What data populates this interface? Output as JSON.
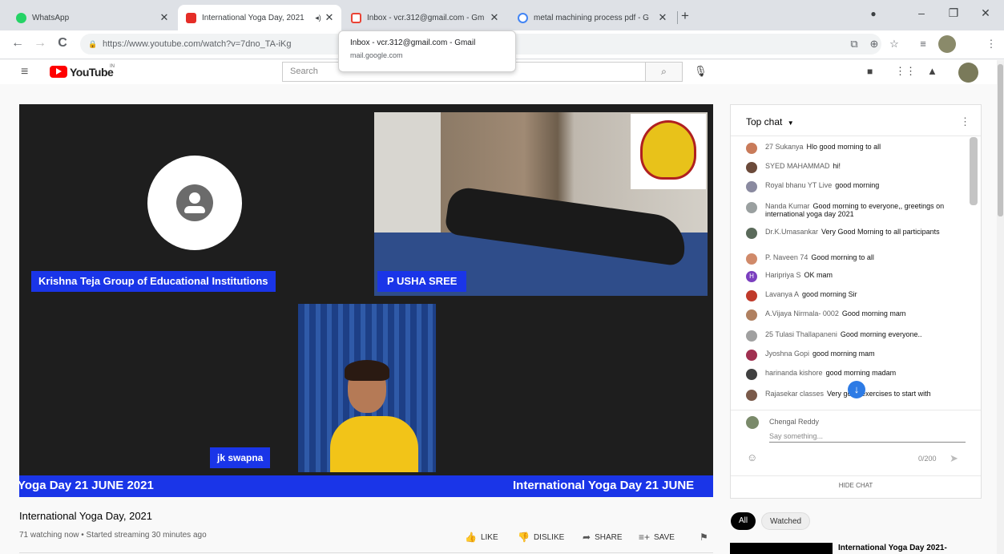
{
  "tabs": [
    {
      "title": "WhatsApp",
      "fav_color": "#25d366"
    },
    {
      "title": "International Yoga Day, 2021",
      "fav_color": "#e52d27"
    },
    {
      "title": "Inbox - vcr.312@gmail.com - Gm",
      "fav_color": "#ea4335"
    },
    {
      "title": "metal machining process pdf - G",
      "fav_color": "#4285f4"
    }
  ],
  "new_tab": "+",
  "address": "https://www.youtube.com/watch?v=7dno_TA-iKg",
  "tooltip": {
    "title": "Inbox - vcr.312@gmail.com - Gmail",
    "url": "mail.google.com"
  },
  "youtube": {
    "logo": "YouTube",
    "region": "IN",
    "search_placeholder": "Search"
  },
  "video": {
    "participants": [
      {
        "name": "Krishna Teja Group of Educational Institutions"
      },
      {
        "name": "P USHA SREE"
      },
      {
        "name": "jk swapna"
      }
    ],
    "ticker_left": "Yoga Day 21 JUNE 2021",
    "ticker_right": "International Yoga Day 21 JUNE"
  },
  "video_info": {
    "title": "International Yoga Day, 2021",
    "meta": "71 watching now • Started streaming 30 minutes ago",
    "actions": [
      "LIKE",
      "DISLIKE",
      "SHARE",
      "SAVE"
    ]
  },
  "chat": {
    "header": "Top chat",
    "messages": [
      {
        "author": "27 Sukanya",
        "text": "Hlo good morning to all",
        "color": "#c97b5a"
      },
      {
        "author": "SYED MAHAMMAD",
        "text": "hi!",
        "color": "#6b4a3a"
      },
      {
        "author": "Royal bhanu YT Live",
        "text": "good morning",
        "color": "#8a8aa0"
      },
      {
        "author": "Nanda Kumar",
        "text": "Good morning to everyone,, greetings on international yoga day 2021",
        "color": "#9aa0a0"
      },
      {
        "author": "Dr.K.Umasankar",
        "text": "Very Good Morning to all participants",
        "color": "#5a6a5a"
      },
      {
        "author": "P. Naveen 74",
        "text": "Good morning to all",
        "color": "#d08a6a"
      },
      {
        "author": "Haripriya S",
        "text": "OK mam",
        "color": "#7b3fbf",
        "initial": "H"
      },
      {
        "author": "Lavanya A",
        "text": "good morning Sir",
        "color": "#c03a2a"
      },
      {
        "author": "A.Vijaya Nirmala- 0002",
        "text": "Good morning mam",
        "color": "#b08060"
      },
      {
        "author": "25 Tulasi Thallapaneni",
        "text": "Good morning everyone..",
        "color": "#a0a0a0"
      },
      {
        "author": "Jyoshna Gopi",
        "text": "good morning mam",
        "color": "#a03050"
      },
      {
        "author": "harinanda kishore",
        "text": "good morning madam",
        "color": "#404040"
      },
      {
        "author": "Rajasekar classes",
        "text": "Very good exercises to start with",
        "color": "#7a5a4a"
      }
    ],
    "current_user": "Chengal Reddy",
    "input_placeholder": "Say something...",
    "counter": "0/200",
    "hide": "HIDE CHAT"
  },
  "chips": [
    "All",
    "Watched"
  ],
  "related": {
    "title": "International Yoga Day 2021-"
  }
}
